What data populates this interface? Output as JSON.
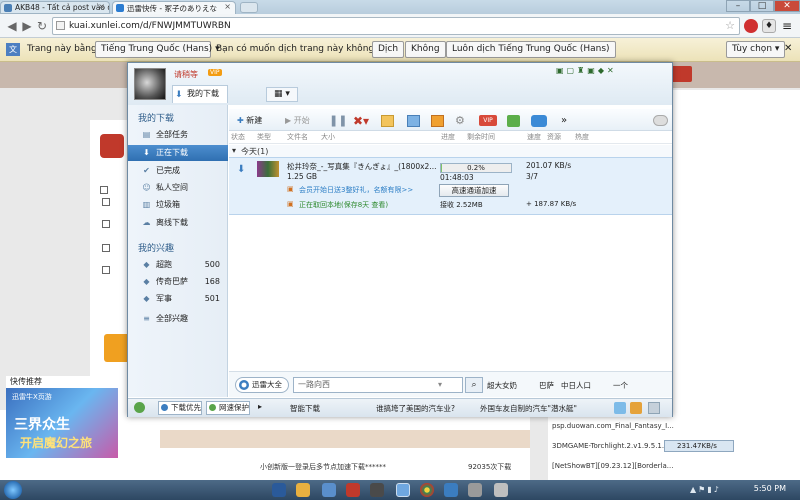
{
  "browser": {
    "tabs": [
      {
        "label": "AKB48 - Tất cả post vào đâ"
      },
      {
        "label": "迅雷快传 - 冢子のありえな"
      }
    ],
    "window_buttons": [
      "–",
      "□",
      "✕"
    ],
    "url": "kuai.xunlei.com/d/FNWJMMTUWRBN"
  },
  "translate_bar": {
    "prefix": "Trang này bằng",
    "language": "Tiếng Trung Quốc (Hans)",
    "question": "Bạn có muốn dịch trang này không?",
    "translate_btn": "Dịch",
    "no_btn": "Không",
    "always_btn": "Luôn dịch Tiếng Trung Quốc (Hans)",
    "options_btn": "Tùy chọn"
  },
  "xunlei": {
    "username": "请稍等",
    "vip_badge": "VIP",
    "my_downloads_tab": "我的下载",
    "sidebar": {
      "section1": "我的下载",
      "items": [
        {
          "label": "全部任务"
        },
        {
          "label": "正在下载"
        },
        {
          "label": "已完成"
        },
        {
          "label": "私人空间"
        },
        {
          "label": "垃圾箱"
        },
        {
          "label": "离线下载"
        }
      ],
      "section2": "我的兴趣",
      "interests": [
        {
          "label": "超跑",
          "count": "500"
        },
        {
          "label": "传奇巴萨",
          "count": "168"
        },
        {
          "label": "军事",
          "count": "501"
        }
      ],
      "all_interests": "全部兴趣"
    },
    "toolbar": {
      "new": "新建",
      "start": "开始",
      "more": "»"
    },
    "columns": [
      "状态",
      "类型",
      "文件名",
      "大小",
      "进度",
      "剩余时间",
      "速度",
      "资源",
      "热度"
    ],
    "day_group": "今天(1)",
    "task": {
      "filename": "松井玲奈_-_写真集『きんぎょ』_(1800x2...",
      "size": "1.25 GB",
      "progress_text": "0.2%",
      "progress": 0.002,
      "remaining": "01:48:03",
      "speed": "201.07 KB/s",
      "resources": "3/7",
      "vip_promo": "会员开始日送3整好礼，名额有限>>",
      "accel_button": "高速通道加速",
      "offline_text": "正在取回本地(保存8天 查看)",
      "received": "接收 2.52MB",
      "offline_speed": "+ 187.87 KB/s"
    },
    "search": {
      "brand": "迅雷大全",
      "placeholder": "一路向西",
      "hotwords": [
        "超大女奶",
        "巴萨",
        "中日人口",
        "一个"
      ]
    },
    "status": {
      "priority": "下载优先",
      "protect": "网速保护",
      "smart": "智能下载",
      "news1": "谁搞垮了美国的汽车业?",
      "news2": "外国车友自制的汽车\"潜水艇\""
    }
  },
  "page": {
    "ad_label": "快传推荐",
    "ad_text1": "三界众生",
    "ad_text2": "开启魔幻之旅",
    "ad_brand": "迅雷牛X页游",
    "right_lines": [
      "psp.duowan.com_Final_Fantasy_I...",
      "3DMGAME-Torchlight.2.v1.9.5.1...",
      "[NetShowBT][09.23.12][Borderla..."
    ],
    "bottom_text": "小创新版一登录后多节点加速下载******",
    "bottom_count": "92035次下载",
    "net_speed": "231.47KB/s"
  },
  "taskbar": {
    "time": "5:50 PM"
  }
}
